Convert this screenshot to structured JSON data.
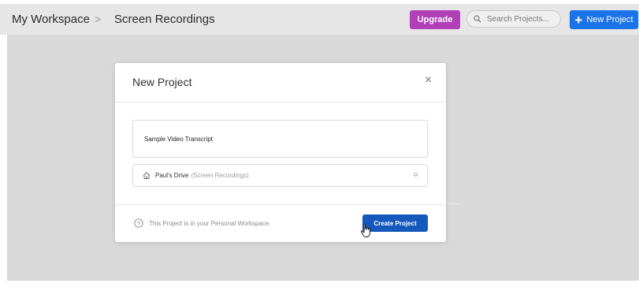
{
  "header": {
    "breadcrumb_root": "My Workspace",
    "breadcrumb_sep": ">",
    "breadcrumb_current": "Screen Recordings",
    "upgrade_label": "Upgrade",
    "search_placeholder": "Search Projects...",
    "new_project_label": "New Project"
  },
  "modal": {
    "title": "New Project",
    "close_symbol": "×",
    "project_name_value": "Sample Video Transcript",
    "drive_name": "Paul's Drive",
    "drive_folder": "(Screen Recordings)",
    "select_arrows": "≎",
    "info_text": "This Project is in your Personal Workspace.",
    "create_label": "Create Project"
  },
  "icons": {
    "search": "search-icon",
    "plus": "plus-icon",
    "close": "close-icon",
    "home": "home-icon",
    "help": "question-circle-icon",
    "cursor": "hand-pointer-icon"
  },
  "colors": {
    "upgrade": "#b13fb8",
    "primary": "#1a73e8",
    "create_button": "#1659bd",
    "header_bg": "#e6e6e6",
    "backdrop": "#d9d9d9"
  }
}
